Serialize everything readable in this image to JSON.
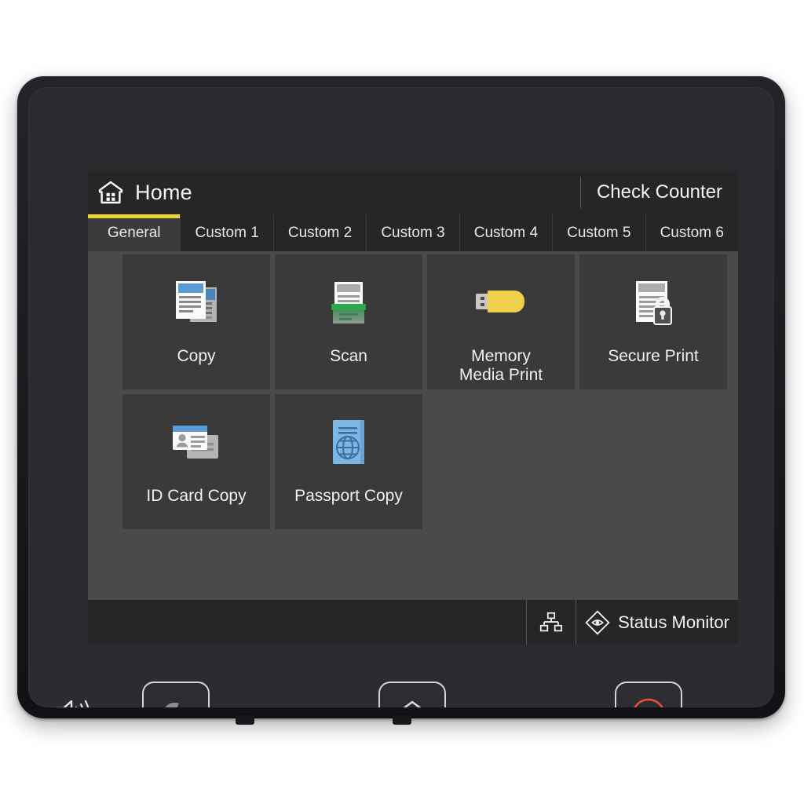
{
  "device": {
    "type": "multifunction-printer-control-panel"
  },
  "screen": {
    "header": {
      "home_icon": "home-icon",
      "title": "Home",
      "check_counter_label": "Check Counter"
    },
    "tabs": [
      {
        "label": "General",
        "active": true
      },
      {
        "label": "Custom 1",
        "active": false
      },
      {
        "label": "Custom 2",
        "active": false
      },
      {
        "label": "Custom 3",
        "active": false
      },
      {
        "label": "Custom 4",
        "active": false
      },
      {
        "label": "Custom 5",
        "active": false
      },
      {
        "label": "Custom 6",
        "active": false
      }
    ],
    "tiles": [
      {
        "label": "Copy",
        "icon": "copy-documents-icon"
      },
      {
        "label": "Scan",
        "icon": "scanner-tray-icon"
      },
      {
        "label": "Memory\nMedia Print",
        "icon": "usb-flash-drive-icon",
        "line1": "Memory",
        "line2": "Media Print"
      },
      {
        "label": "Secure Print",
        "icon": "document-lock-icon"
      },
      {
        "label": "ID Card Copy",
        "icon": "id-card-icon"
      },
      {
        "label": "Passport Copy",
        "icon": "passport-globe-icon"
      }
    ],
    "status_bar": {
      "network_icon": "network-tree-icon",
      "monitor_icon": "eye-diamond-icon",
      "monitor_label": "Status Monitor"
    }
  },
  "hardware": {
    "speaker_icon": "speaker-volume-icon",
    "keys": [
      {
        "name": "energy-saver-key",
        "icon": "crescent-moon-icon"
      },
      {
        "name": "home-key",
        "icon": "home-house-icon"
      },
      {
        "name": "stop-key",
        "icon": "stop-triangle-icon"
      }
    ],
    "indicators": [
      {
        "name": "data-indicator",
        "icon": "arrow-into-diamond-icon"
      },
      {
        "name": "error-indicator",
        "icon": "warning-triangle-icon"
      }
    ]
  },
  "colors": {
    "accent_yellow": "#edd335",
    "stop_red": "#e8503a",
    "tile_bg": "#3a3a3a",
    "grid_bg": "#4a4a4a",
    "screen_bg": "#2a2a2a",
    "copy_blue": "#5b9bd5",
    "scan_green": "#2aa84a",
    "usb_yellow": "#f2cf4a",
    "passport_blue": "#7fb5e3"
  }
}
